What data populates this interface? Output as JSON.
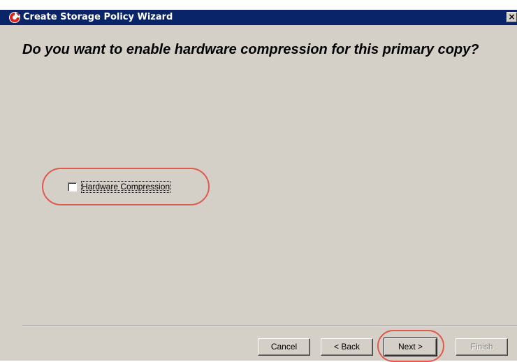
{
  "window": {
    "title": "Create Storage Policy Wizard",
    "close_label": "×"
  },
  "page": {
    "heading": "Do you want to enable hardware compression for this primary copy?"
  },
  "options": {
    "hardware_compression": {
      "label": "Hardware Compression",
      "checked": false
    }
  },
  "buttons": {
    "cancel": "Cancel",
    "back": "< Back",
    "next": "Next >",
    "finish": "Finish"
  },
  "colors": {
    "title_bar": "#0a246a",
    "dialog_background": "#d4d0c8",
    "highlight_annotation": "#e05a4f"
  }
}
